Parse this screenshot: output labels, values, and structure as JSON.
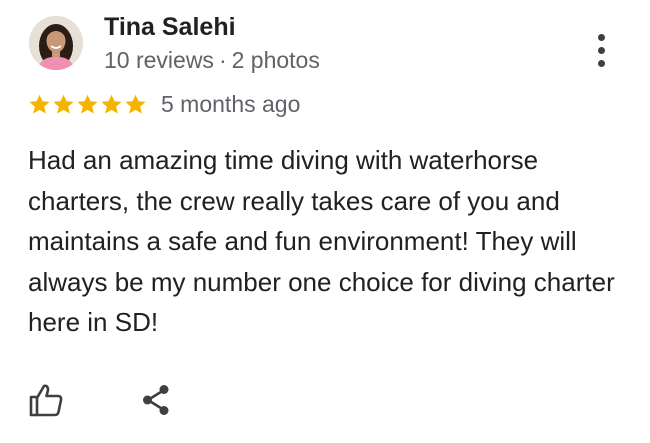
{
  "review": {
    "reviewer_name": "Tina Salehi",
    "reviews_count": "10 reviews",
    "separator": "·",
    "photos_count": "2 photos",
    "rating": 5,
    "rating_max": 5,
    "date": "5 months ago",
    "text": "Had an amazing time diving with waterhorse charters, the crew really takes care of you and maintains a safe and fun environment! They will always be my number one choice for diving charter here in SD!"
  },
  "icons": {
    "more": "more-vert-icon",
    "like": "thumbs-up-icon",
    "share": "share-icon",
    "star": "star-icon"
  },
  "colors": {
    "star": "#f6b400",
    "name": "#202124",
    "meta": "#5f6368",
    "icon": "#3c4043"
  }
}
